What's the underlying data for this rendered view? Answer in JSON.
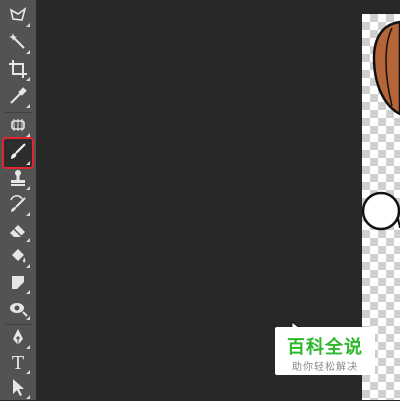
{
  "tools": [
    {
      "id": "lasso",
      "icon": "lasso-icon"
    },
    {
      "id": "magic-wand",
      "icon": "magic-wand-icon"
    },
    {
      "id": "crop",
      "icon": "crop-icon"
    },
    {
      "id": "eyedropper",
      "icon": "eyedropper-icon"
    },
    {
      "id": "healing-brush",
      "icon": "healing-brush-icon"
    },
    {
      "id": "brush",
      "icon": "brush-icon",
      "selected": true
    },
    {
      "id": "clone-stamp",
      "icon": "clone-stamp-icon"
    },
    {
      "id": "history-brush",
      "icon": "history-brush-icon"
    },
    {
      "id": "eraser",
      "icon": "eraser-icon"
    },
    {
      "id": "paint-bucket",
      "icon": "paint-bucket-icon"
    },
    {
      "id": "blur",
      "icon": "blur-icon"
    },
    {
      "id": "dodge",
      "icon": "dodge-icon"
    },
    {
      "id": "pen",
      "icon": "pen-icon"
    },
    {
      "id": "type",
      "icon": "type-icon",
      "glyph": "T"
    },
    {
      "id": "path-selection",
      "icon": "path-selection-icon"
    }
  ],
  "colors": {
    "toolbar_bg": "#535353",
    "workspace_bg": "#282828",
    "selection_highlight": "#e0252e",
    "artwork_brown": "#b5653a",
    "artwork_outline": "#111111",
    "watermark_green": "#2eb82e"
  },
  "watermark": {
    "title": "百科全说",
    "subtitle": "助你轻松解决"
  }
}
